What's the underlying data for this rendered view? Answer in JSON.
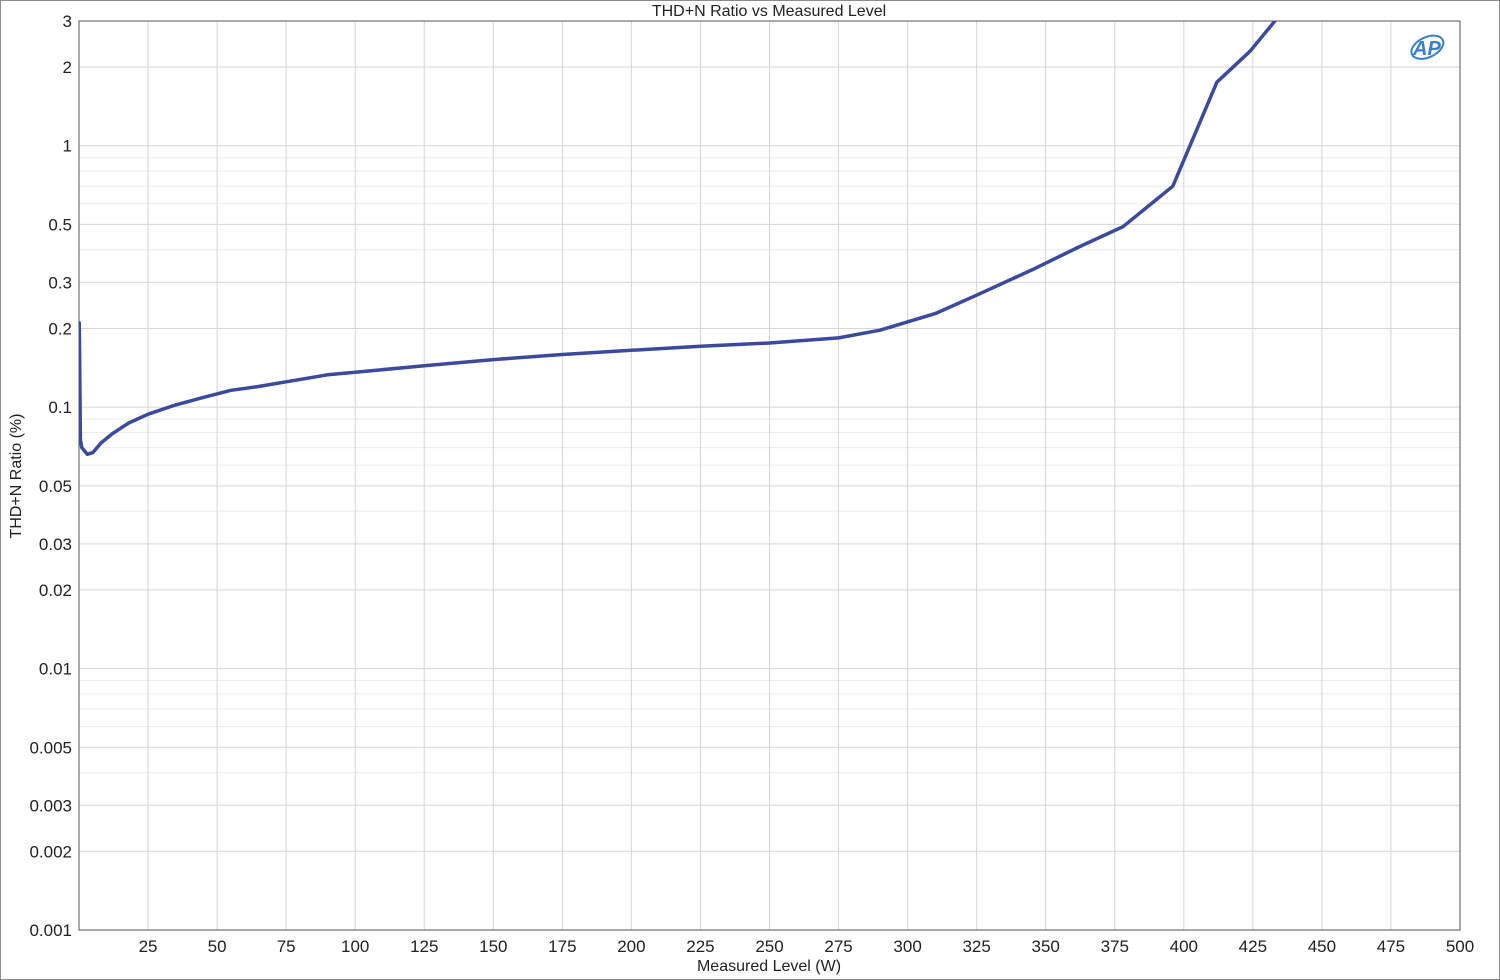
{
  "chart_data": {
    "type": "line",
    "title": "THD+N Ratio vs Measured Level",
    "xlabel": "Measured Level (W)",
    "ylabel": "THD+N Ratio (%)",
    "xlim": [
      0,
      500
    ],
    "ylim": [
      0.001,
      3
    ],
    "y_scale": "log",
    "grid": true,
    "x_ticks": [
      25,
      50,
      75,
      100,
      125,
      150,
      175,
      200,
      225,
      250,
      275,
      300,
      325,
      350,
      375,
      400,
      425,
      450,
      475,
      500
    ],
    "x_tick_labels": [
      "25",
      "50",
      "75",
      "100",
      "125",
      "150",
      "175",
      "200",
      "225",
      "250",
      "275",
      "300",
      "325",
      "350",
      "375",
      "400",
      "425",
      "450",
      "475",
      "500"
    ],
    "y_ticks": [
      0.001,
      0.002,
      0.003,
      0.005,
      0.01,
      0.02,
      0.03,
      0.05,
      0.1,
      0.2,
      0.3,
      0.5,
      1,
      2,
      3
    ],
    "y_tick_labels": [
      "0.001",
      "0.002",
      "0.003",
      "0.005",
      "0.01",
      "0.02",
      "0.03",
      "0.05",
      "0.1",
      "0.2",
      "0.3",
      "0.5",
      "1",
      "2",
      "3"
    ],
    "series": [
      {
        "color": "#3b4a9e",
        "x": [
          0.1,
          0.5,
          1,
          2,
          3,
          5,
          8,
          12,
          18,
          25,
          35,
          45,
          55,
          65,
          75,
          90,
          100,
          125,
          150,
          175,
          200,
          225,
          250,
          275,
          290,
          310,
          325,
          345,
          362,
          378,
          396,
          412,
          424,
          433
        ],
        "y": [
          0.21,
          0.075,
          0.07,
          0.068,
          0.066,
          0.067,
          0.073,
          0.079,
          0.087,
          0.094,
          0.102,
          0.109,
          0.116,
          0.12,
          0.125,
          0.133,
          0.136,
          0.144,
          0.152,
          0.159,
          0.165,
          0.171,
          0.176,
          0.184,
          0.197,
          0.228,
          0.268,
          0.335,
          0.41,
          0.49,
          0.7,
          1.75,
          2.3,
          3.0
        ]
      }
    ]
  },
  "logo": {
    "text": "AP",
    "color": "#3a7fc9"
  }
}
